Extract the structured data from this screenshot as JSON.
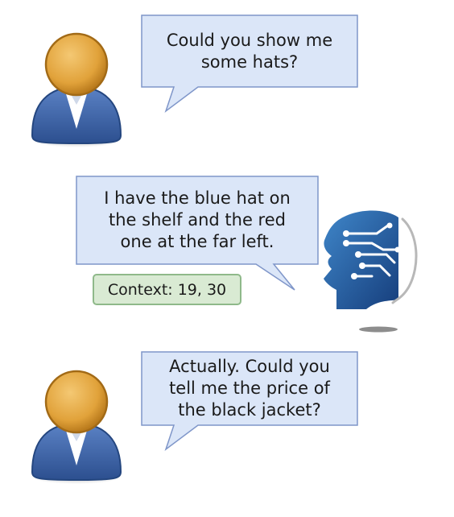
{
  "messages": [
    {
      "speaker": "user",
      "text": "Could you show me\nsome hats?"
    },
    {
      "speaker": "assistant",
      "text": "I have the blue hat on\nthe shelf and the red\none at the far left."
    },
    {
      "speaker": "user",
      "text": "Actually. Could you\ntell me the price of\nthe black jacket?"
    }
  ],
  "context_badge": {
    "label": "Context: 19, 30"
  },
  "icons": {
    "user": "user-avatar-icon",
    "assistant": "ai-head-icon"
  },
  "colors": {
    "bubble_fill": "#dbe6f8",
    "bubble_stroke": "#7f96c9",
    "avatar_head": "#e1a23a",
    "avatar_body": "#3d63a6",
    "ai_head": "#1f5aa1",
    "context_fill": "#d9ead3",
    "context_stroke": "#8fb98a"
  }
}
